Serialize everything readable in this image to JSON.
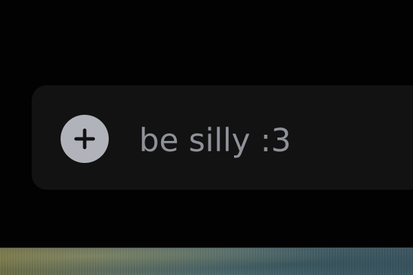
{
  "composer": {
    "add_button_icon": "plus-circle-icon",
    "message_text": "be silly :3"
  },
  "colors": {
    "background": "#020202",
    "composer_background": "#121212",
    "add_button": "#b0b3ba",
    "text": "#8f9199"
  }
}
